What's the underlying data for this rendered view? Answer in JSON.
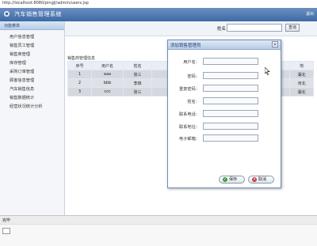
{
  "browser": {
    "url": "http://localhost:8080/pingjl/admin/users.jsp"
  },
  "header": {
    "title": "汽车销售管理系统",
    "logout": "退出"
  },
  "sidebar": {
    "heading": "功能菜单",
    "items": [
      {
        "label": "用户信息管理"
      },
      {
        "label": "销售员工管理"
      },
      {
        "label": "销售商管理"
      },
      {
        "label": "库存管理"
      },
      {
        "label": "采购订单管理"
      },
      {
        "label": "顾客信息管理"
      },
      {
        "label": "汽车销售信息"
      },
      {
        "label": "销售数据统计"
      },
      {
        "label": "经营状况统计分析"
      }
    ]
  },
  "toolbar": {
    "search_label": "姓名",
    "search_button": "查询"
  },
  "grid": {
    "title": "销售商管理信息",
    "columns": [
      "序号",
      "用户名",
      "姓名",
      "",
      "",
      "",
      "",
      "",
      "",
      "地"
    ],
    "rows": [
      [
        "1",
        "aaa",
        "张三",
        "",
        "",
        "",
        "",
        "",
        "",
        "湖北"
      ],
      [
        "2",
        "bbb",
        "李四",
        "",
        "",
        "",
        "",
        "",
        "",
        "河北"
      ],
      [
        "3",
        "ccc",
        "张三",
        "",
        "",
        "",
        "",
        "",
        "",
        "湖北"
      ]
    ]
  },
  "dialog": {
    "title": "添加销售管理员",
    "fields": [
      {
        "label": "用户名："
      },
      {
        "label": "密码："
      },
      {
        "label": "重复密码："
      },
      {
        "label": "姓名："
      },
      {
        "label": "联系电话："
      },
      {
        "label": "联系地址："
      },
      {
        "label": "电子邮箱："
      }
    ],
    "ok_label": "保存",
    "cancel_label": "取消"
  },
  "status": {
    "text": "完毕"
  },
  "colors": {
    "header": "#3d6aa6",
    "dialog_border": "#6d8fbf",
    "row_fill": "#d6d8df"
  }
}
